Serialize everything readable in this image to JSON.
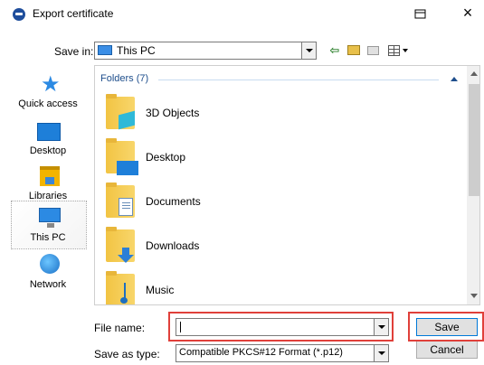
{
  "window": {
    "title": "Export certificate",
    "icons": {
      "app": "certificate-app-icon",
      "restore": "restore-window-icon",
      "close": "close-icon"
    },
    "close_glyph": "×"
  },
  "toolbar": {
    "save_in_label": "Save in:",
    "save_in_value": "This PC",
    "icons": [
      "back-arrow-icon",
      "up-folder-icon",
      "new-folder-icon",
      "view-menu-icon"
    ]
  },
  "places": [
    {
      "label": "Quick access",
      "icon": "star-icon"
    },
    {
      "label": "Desktop",
      "icon": "desktop-icon"
    },
    {
      "label": "Libraries",
      "icon": "libraries-icon"
    },
    {
      "label": "This PC",
      "icon": "this-pc-icon",
      "selected": true
    },
    {
      "label": "Network",
      "icon": "network-icon"
    }
  ],
  "file_list": {
    "group_header": "Folders (7)",
    "items": [
      {
        "name": "3D Objects",
        "icon": "3d-objects-folder-icon"
      },
      {
        "name": "Desktop",
        "icon": "desktop-folder-icon"
      },
      {
        "name": "Documents",
        "icon": "documents-folder-icon"
      },
      {
        "name": "Downloads",
        "icon": "downloads-folder-icon"
      },
      {
        "name": "Music",
        "icon": "music-folder-icon"
      }
    ]
  },
  "form": {
    "file_name_label": "File name:",
    "file_name_value": "",
    "save_as_type_label": "Save as type:",
    "save_as_type_value": "Compatible PKCS#12 Format (*.p12)"
  },
  "buttons": {
    "save": "Save",
    "cancel": "Cancel"
  },
  "highlight_color": "#e0403a",
  "accent_color": "#0078d7"
}
